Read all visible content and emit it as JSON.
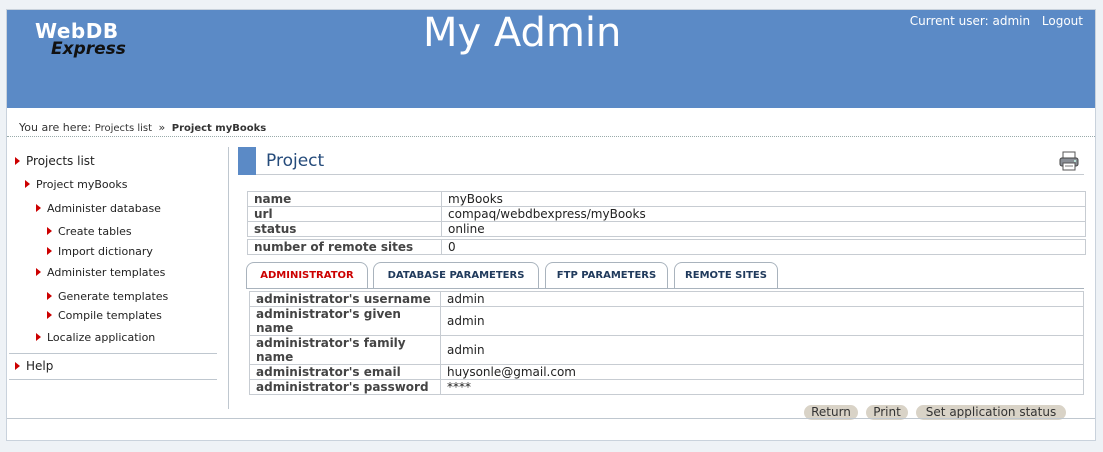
{
  "header": {
    "logo_line1": "WebDB",
    "logo_line2": "Express",
    "app_title": "My Admin",
    "current_user": "Current user: admin",
    "logout_label": "Logout"
  },
  "breadcrumb": {
    "prefix": "You are here:",
    "link": "Projects list",
    "separator": "»",
    "current": "Project myBooks"
  },
  "sidebar": {
    "items": [
      {
        "label": "Projects list"
      },
      {
        "label": "Project myBooks"
      },
      {
        "label": "Administer database"
      },
      {
        "label": "Create tables"
      },
      {
        "label": "Import dictionary"
      },
      {
        "label": "Administer templates"
      },
      {
        "label": "Generate templates"
      },
      {
        "label": "Compile templates"
      },
      {
        "label": "Localize application"
      },
      {
        "label": "Help"
      }
    ]
  },
  "section": {
    "title": "Project",
    "printer_icon": "printer-icon"
  },
  "project": {
    "rows": [
      {
        "key": "name",
        "value": "myBooks"
      },
      {
        "key": "url",
        "value": "compaq/webdbexpress/myBooks"
      },
      {
        "key": "status",
        "value": "online"
      },
      {
        "key": "number of remote sites",
        "value": "0"
      }
    ]
  },
  "tabs": [
    {
      "label": "ADMINISTRATOR",
      "active": true
    },
    {
      "label": "DATABASE PARAMETERS",
      "active": false
    },
    {
      "label": "FTP PARAMETERS",
      "active": false
    },
    {
      "label": "REMOTE SITES",
      "active": false
    }
  ],
  "administrator": {
    "rows": [
      {
        "key": "administrator's username",
        "value": "admin"
      },
      {
        "key": "administrator's given name",
        "value": "admin"
      },
      {
        "key": "administrator's family name",
        "value": "admin"
      },
      {
        "key": "administrator's email",
        "value": "huysonle@gmail.com"
      },
      {
        "key": "administrator's password",
        "value": "****"
      }
    ]
  },
  "actions": {
    "return_label": "Return",
    "print_label": "Print",
    "set_status_label": "Set application status"
  },
  "colors": {
    "header_bg": "#5b8ac6",
    "active_tab": "#cc0000",
    "arrow": "#cc0000"
  }
}
